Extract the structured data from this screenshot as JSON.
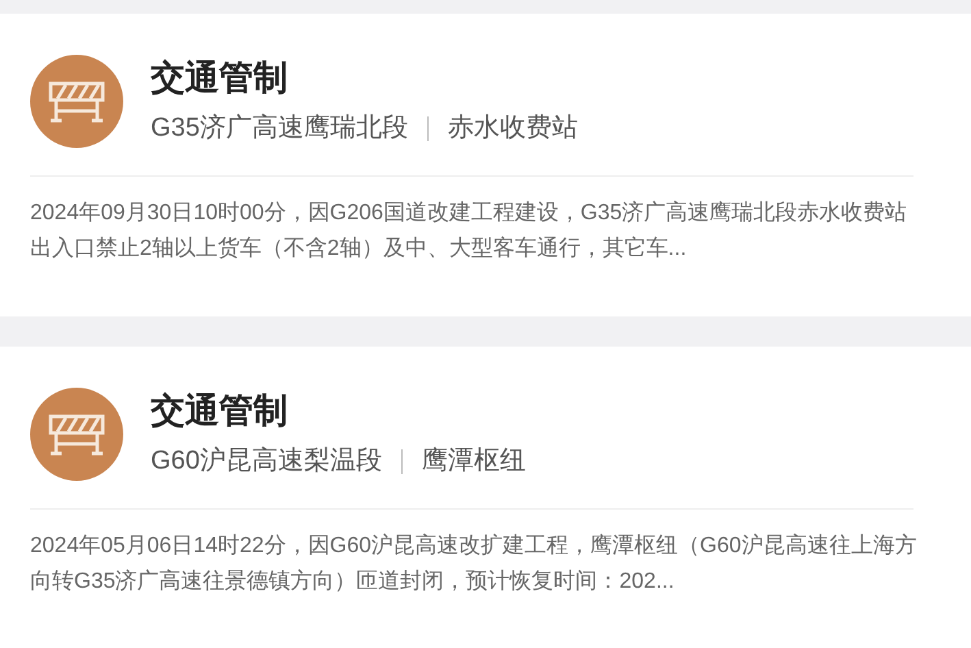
{
  "notices": [
    {
      "title": "交通管制",
      "road": "G35济广高速鹰瑞北段",
      "location": "赤水收费站",
      "description": "2024年09月30日10时00分，因G206国道改建工程建设，G35济广高速鹰瑞北段赤水收费站出入口禁止2轴以上货车（不含2轴）及中、大型客车通行，其它车..."
    },
    {
      "title": "交通管制",
      "road": "G60沪昆高速梨温段",
      "location": "鹰潭枢纽",
      "description": "2024年05月06日14时22分，因G60沪昆高速改扩建工程，鹰潭枢纽（G60沪昆高速往上海方向转G35济广高速往景德镇方向）匝道封闭，预计恢复时间：202..."
    }
  ]
}
